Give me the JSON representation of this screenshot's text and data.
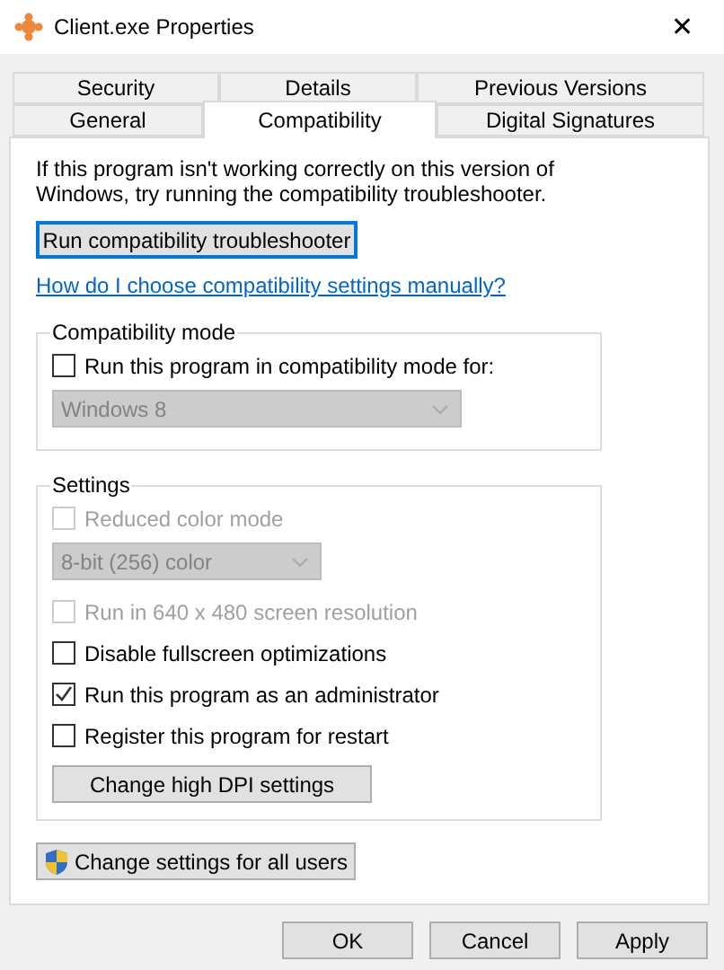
{
  "window": {
    "title": "Client.exe Properties",
    "close": "✕"
  },
  "tab_rows": [
    [
      {
        "label": "Security",
        "selected": false
      },
      {
        "label": "Details",
        "selected": false
      },
      {
        "label": "Previous Versions",
        "selected": false
      }
    ],
    [
      {
        "label": "General",
        "selected": false
      },
      {
        "label": "Compatibility",
        "selected": true
      },
      {
        "label": "Digital Signatures",
        "selected": false
      }
    ]
  ],
  "intro": "If this program isn't working correctly on this version of Windows, try running the compatibility troubleshooter.",
  "troubleshooter_button": "Run compatibility troubleshooter",
  "help_link": "How do I choose compatibility settings manually?",
  "compatibility_mode": {
    "title": "Compatibility mode",
    "items": [
      {
        "kind": "checkbox",
        "label": "Run this program in compatibility mode for:",
        "checked": false,
        "disabled": false
      },
      {
        "kind": "dropdown",
        "value": "Windows 8",
        "disabled": true
      }
    ]
  },
  "settings": {
    "title": "Settings",
    "items": [
      {
        "kind": "checkbox",
        "label": "Reduced color mode",
        "checked": false,
        "disabled": true
      },
      {
        "kind": "dropdown",
        "value": "8-bit (256) color",
        "disabled": true
      },
      {
        "kind": "checkbox",
        "label": "Run in 640 x 480 screen resolution",
        "checked": false,
        "disabled": true
      },
      {
        "kind": "checkbox",
        "label": "Disable fullscreen optimizations",
        "checked": false,
        "disabled": false
      },
      {
        "kind": "checkbox",
        "label": "Run this program as an administrator",
        "checked": true,
        "disabled": false
      },
      {
        "kind": "checkbox",
        "label": "Register this program for restart",
        "checked": false,
        "disabled": false
      },
      {
        "kind": "button",
        "label": "Change high DPI settings"
      }
    ]
  },
  "all_users_button": "Change settings for all users",
  "buttons": [
    "OK",
    "Cancel",
    "Apply"
  ]
}
